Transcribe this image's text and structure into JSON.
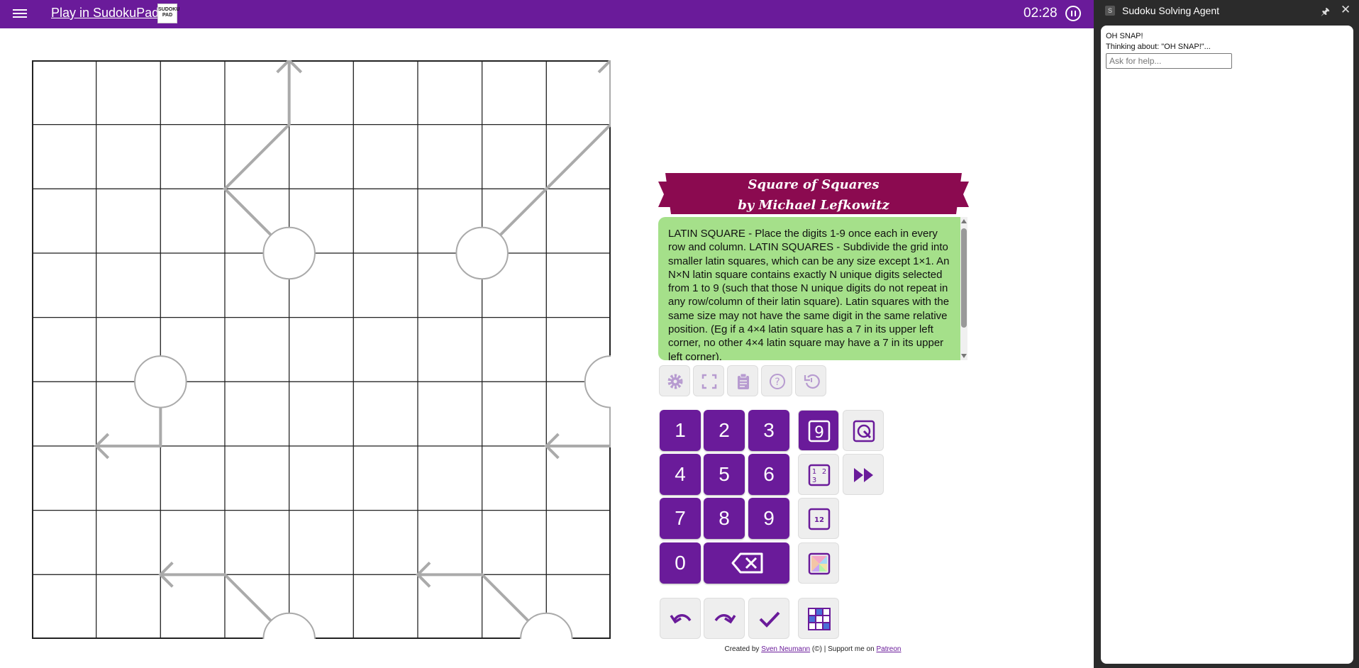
{
  "header": {
    "title": "Play in SudokuPad",
    "logo_text": "SUDOKU PAD",
    "timer": "02:28"
  },
  "puzzle": {
    "title_line1": "Square of Squares",
    "title_line2": "by Michael Lefkowitz",
    "rules": "LATIN SQUARE - Place the digits 1-9 once each in every row and column. LATIN SQUARES - Subdivide the grid into smaller latin squares, which can be any size except 1×1. An N×N latin square contains exactly N unique digits selected from 1 to 9 (such that those N unique digits do not repeat in any row/column of their latin square). Latin squares with the same size may not have the same digit in the same relative position. (Eg if a 4×4 latin square has a 7 in its upper left corner, no other 4×4 latin square may have a 7 in its upper left corner).",
    "grid_size": 9,
    "arrows": [
      {
        "bulb": [
          3,
          4
        ],
        "path": [
          [
            3,
            4
          ],
          [
            2,
            3
          ],
          [
            1,
            4
          ],
          [
            0,
            4
          ]
        ]
      },
      {
        "bulb": [
          3,
          7
        ],
        "path": [
          [
            3,
            7
          ],
          [
            2,
            8
          ],
          [
            1,
            9
          ],
          [
            0,
            9
          ]
        ]
      },
      {
        "bulb": [
          5,
          2
        ],
        "path": [
          [
            5,
            2
          ],
          [
            6,
            2
          ],
          [
            6,
            1
          ]
        ]
      },
      {
        "bulb": [
          5,
          9
        ],
        "path": [
          [
            5,
            9
          ],
          [
            6,
            9
          ],
          [
            6,
            8
          ]
        ]
      },
      {
        "bulb": [
          9,
          4
        ],
        "path": [
          [
            9,
            4
          ],
          [
            8,
            3
          ],
          [
            8,
            2
          ]
        ]
      },
      {
        "bulb": [
          9,
          8
        ],
        "path": [
          [
            9,
            8
          ],
          [
            8,
            7
          ],
          [
            8,
            6
          ]
        ]
      }
    ]
  },
  "toolbar": {
    "settings": "gear-icon",
    "fullscreen": "fullscreen-icon",
    "clipboard": "clipboard-icon",
    "help": "help-icon",
    "restart": "restart-icon"
  },
  "keypad": {
    "digits": [
      "1",
      "2",
      "3",
      "4",
      "5",
      "6",
      "7",
      "8",
      "9",
      "0"
    ],
    "modes": [
      "normal",
      "corner",
      "centre",
      "color"
    ],
    "mode_labels": {
      "corner": "1 2 3",
      "centre": "12"
    }
  },
  "credits": {
    "prefix": "Created by",
    "author": "Sven Neumann",
    "middle": "(©) | Support me on",
    "patreon": "Patreon"
  },
  "side_panel": {
    "icon_letter": "S",
    "title": "Sudoku Solving Agent",
    "line1": "OH SNAP!",
    "line2": "Thinking about: \"OH SNAP!\"...",
    "input_placeholder": "Ask for help..."
  },
  "colors": {
    "brand": "#6a1b9a",
    "banner": "#8b0a50",
    "rules_bg": "#a5e08a",
    "arrow": "#aaaaaa"
  }
}
